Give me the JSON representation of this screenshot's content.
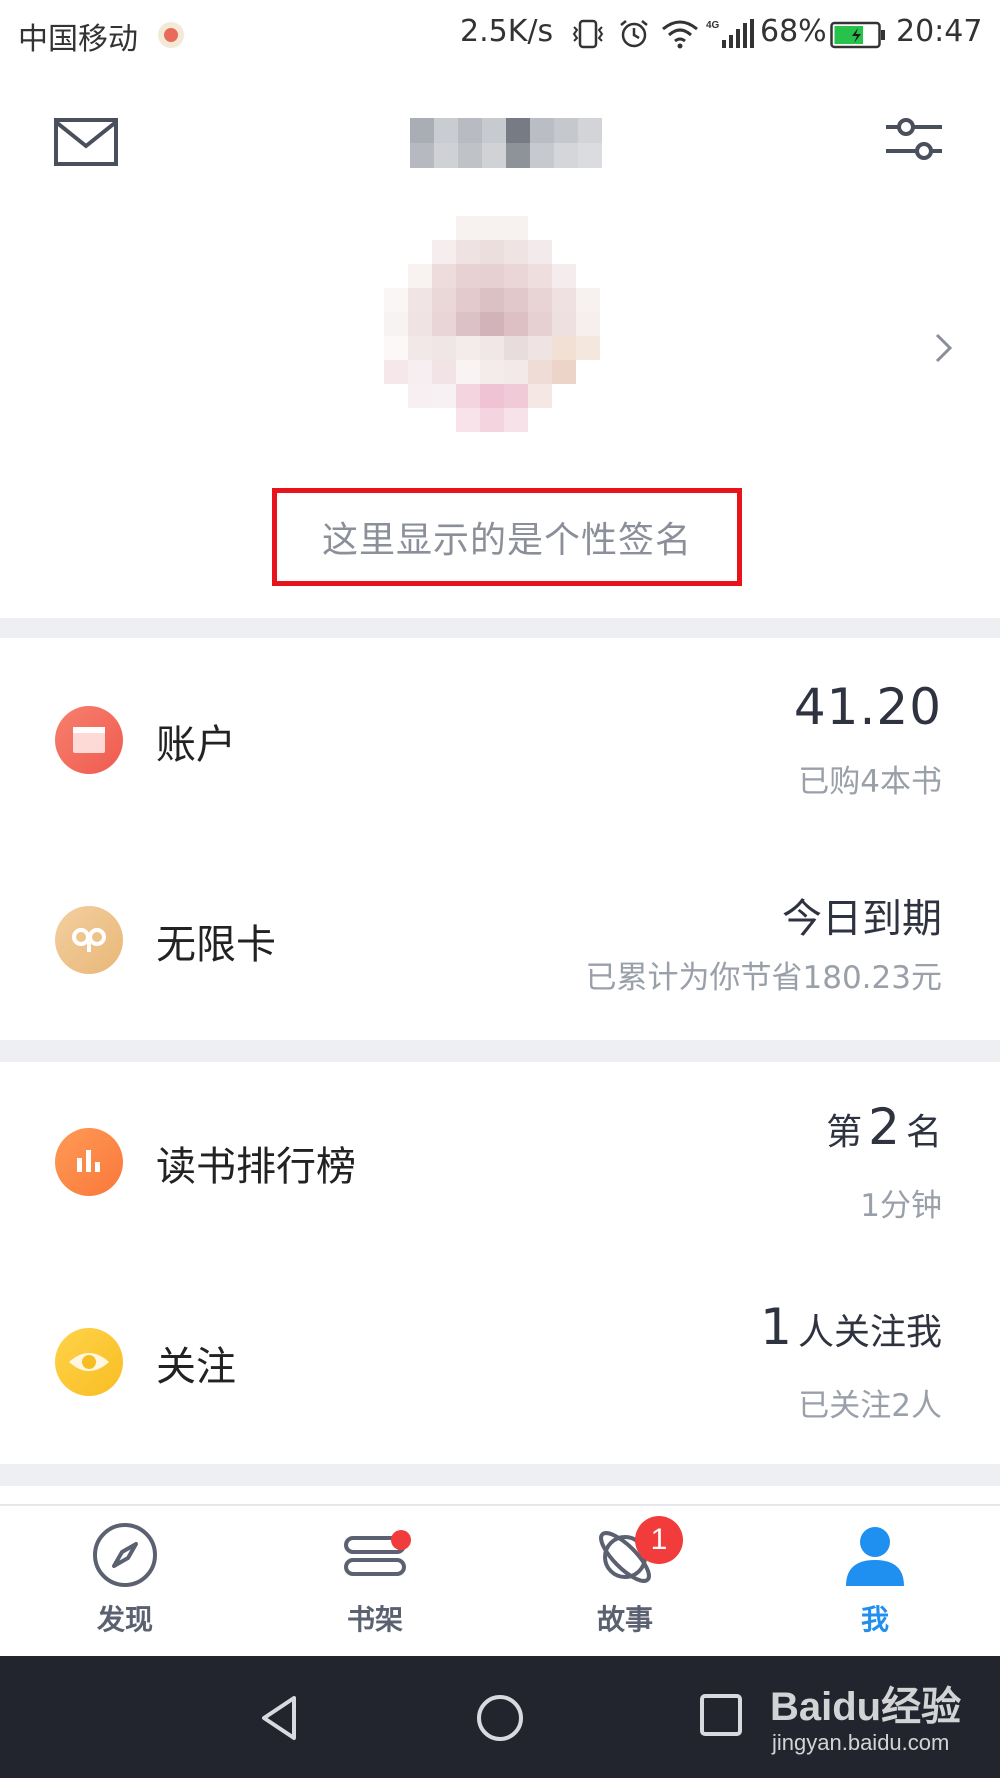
{
  "status_bar": {
    "carrier": "中国移动",
    "net_speed": "2.5K/s",
    "battery_percent": "68%",
    "battery_level": 0.68,
    "time": "20:47",
    "icons": [
      "vibrate-icon",
      "alarm-icon",
      "wifi-icon",
      "signal-4g-icon",
      "battery-icon"
    ]
  },
  "header": {
    "left_icon": "mail-icon",
    "right_icon": "settings-sliders-icon"
  },
  "profile": {
    "signature": "这里显示的是个性签名",
    "highlight_color": "#e8141b"
  },
  "rows": {
    "account": {
      "label": "账户",
      "value": "41.20",
      "sub": "已购4本书",
      "icon": "wallet-icon",
      "color": "#f26a5c"
    },
    "card": {
      "label": "无限卡",
      "value": "今日到期",
      "sub": "已累计为你节省180.23元",
      "icon": "infinity-icon",
      "color": "#eec28a"
    },
    "rank": {
      "label": "读书排行榜",
      "prefix": "第",
      "value": "2",
      "suffix": "名",
      "sub": "1分钟",
      "icon": "bar-chart-icon",
      "color": "#fb8646"
    },
    "follow": {
      "label": "关注",
      "value": "1",
      "suffix": "人关注我",
      "sub": "已关注2人",
      "icon": "eye-icon",
      "color": "#fbc731"
    }
  },
  "tabs": [
    {
      "label": "发现",
      "icon": "compass-icon"
    },
    {
      "label": "书架",
      "icon": "bookshelf-icon",
      "dot": true
    },
    {
      "label": "故事",
      "icon": "planet-icon",
      "badge": "1"
    },
    {
      "label": "我",
      "icon": "person-icon",
      "active": true
    }
  ],
  "accent_color": "#1f8ff0",
  "watermark": {
    "brand": "Baidu经验",
    "url": "jingyan.baidu.com"
  }
}
